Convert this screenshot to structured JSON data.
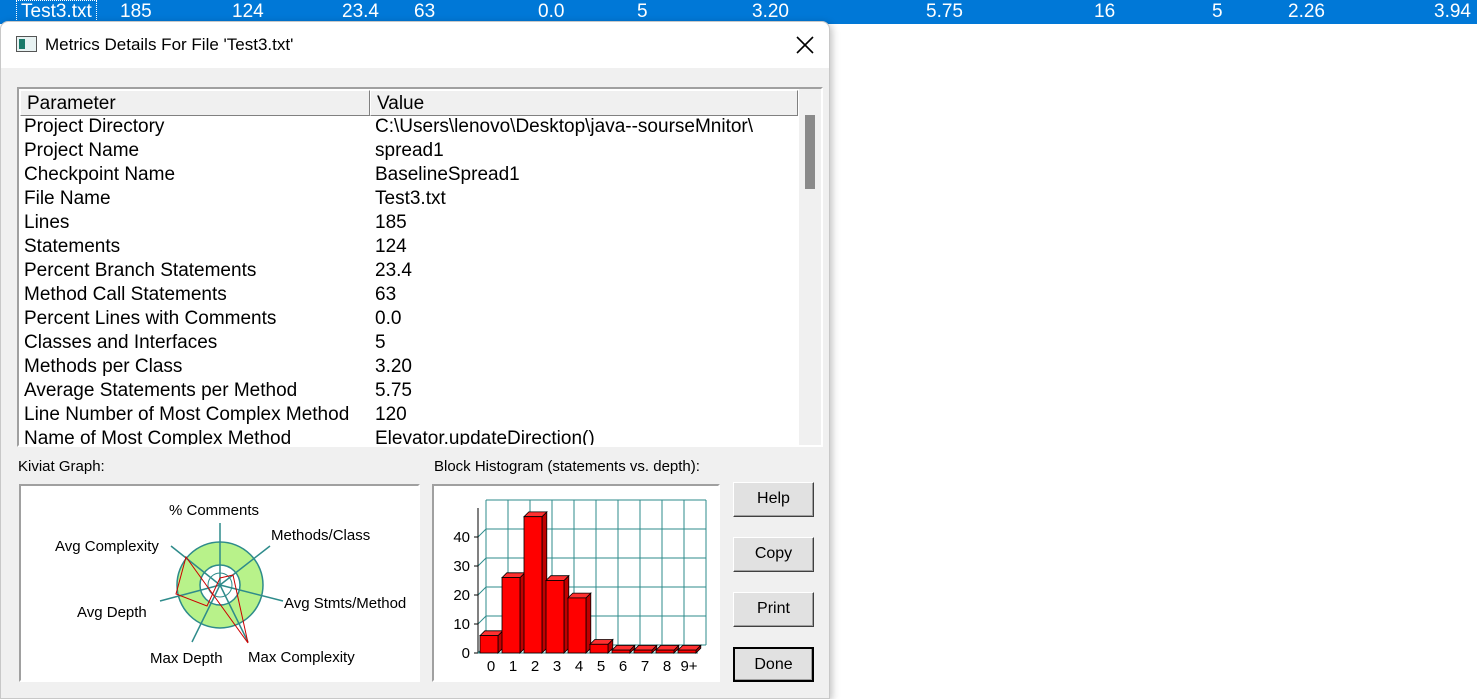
{
  "background_row": {
    "cells": [
      "Test3.txt",
      "185",
      "124",
      "23.4",
      "63",
      "0.0",
      "5",
      "3.20",
      "5.75",
      "16",
      "5",
      "2.26",
      "3.94"
    ]
  },
  "dialog": {
    "title": "Metrics Details For File 'Test3.txt'",
    "close_icon": "close-icon"
  },
  "list": {
    "columns": [
      "Parameter",
      "Value"
    ],
    "rows": [
      {
        "parameter": "Project Directory",
        "value": "C:\\Users\\lenovo\\Desktop\\java--sourseMnitor\\"
      },
      {
        "parameter": "Project Name",
        "value": "spread1"
      },
      {
        "parameter": "Checkpoint Name",
        "value": "BaselineSpread1"
      },
      {
        "parameter": "File Name",
        "value": "Test3.txt"
      },
      {
        "parameter": "Lines",
        "value": "185"
      },
      {
        "parameter": "Statements",
        "value": "124"
      },
      {
        "parameter": "Percent Branch Statements",
        "value": "23.4"
      },
      {
        "parameter": "Method Call Statements",
        "value": "63"
      },
      {
        "parameter": "Percent Lines with Comments",
        "value": "0.0"
      },
      {
        "parameter": "Classes and Interfaces",
        "value": "5"
      },
      {
        "parameter": "Methods per Class",
        "value": "3.20"
      },
      {
        "parameter": "Average Statements per Method",
        "value": "5.75"
      },
      {
        "parameter": "Line Number of Most Complex Method",
        "value": "120"
      },
      {
        "parameter": "Name of Most Complex Method",
        "value": "Elevator.updateDirection()"
      }
    ]
  },
  "kiviat": {
    "label": "Kiviat Graph:",
    "axes": [
      "% Comments",
      "Methods/Class",
      "Avg Stmts/Method",
      "Max Complexity",
      "Max Depth",
      "Avg Depth",
      "Avg Complexity"
    ],
    "colors": {
      "ring": "#b8f28a",
      "axis": "#2e8b8b",
      "polygon": "#cc0000"
    }
  },
  "histogram": {
    "label": "Block Histogram (statements vs. depth):",
    "colors": {
      "bar": "#ff0000",
      "grid": "#2e8b8b"
    }
  },
  "chart_data": {
    "type": "bar",
    "categories": [
      "0",
      "1",
      "2",
      "3",
      "4",
      "5",
      "6",
      "7",
      "8",
      "9+"
    ],
    "values": [
      6,
      26,
      47,
      25,
      19,
      3,
      1,
      1,
      1,
      1
    ],
    "yticks": [
      "0",
      "10",
      "20",
      "30",
      "40"
    ],
    "ylim": [
      0,
      50
    ],
    "title": "Block Histogram (statements vs. depth):"
  },
  "buttons": {
    "help": "Help",
    "copy": "Copy",
    "print": "Print",
    "done": "Done"
  }
}
